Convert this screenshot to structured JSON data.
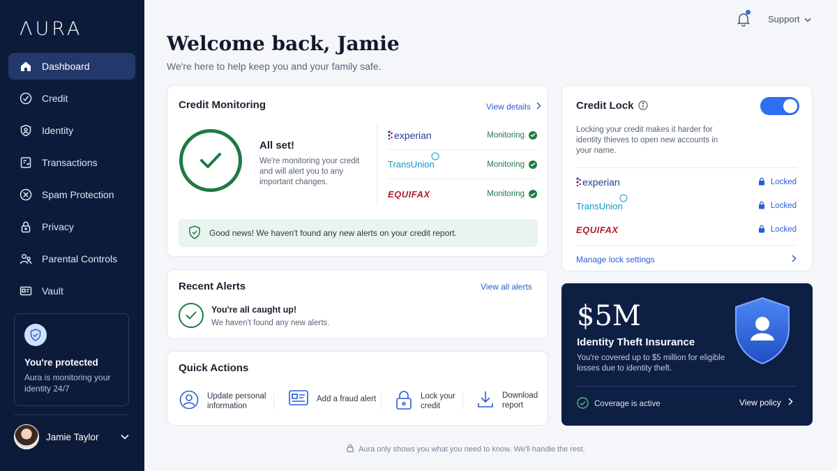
{
  "brand": {
    "logo_text": "ΛURA",
    "accent": "#2f6ef0",
    "success": "#1e7a43",
    "sidebar_bg": "#0d1b3a"
  },
  "sidebar": {
    "items": [
      {
        "label": "Dashboard",
        "icon": "home-icon",
        "active": true
      },
      {
        "label": "Credit",
        "icon": "credit-gauge-icon"
      },
      {
        "label": "Identity",
        "icon": "identity-shield-icon"
      },
      {
        "label": "Transactions",
        "icon": "transactions-icon"
      },
      {
        "label": "Spam Protection",
        "icon": "spam-block-icon"
      },
      {
        "label": "Privacy",
        "icon": "lock-icon"
      },
      {
        "label": "Parental Controls",
        "icon": "family-icon"
      },
      {
        "label": "Vault",
        "icon": "vault-card-icon"
      }
    ],
    "protect_card": {
      "title": "You're protected",
      "subtitle": "Aura is monitoring your identity 24/7"
    },
    "user": {
      "name": "Jamie Taylor"
    }
  },
  "topbar": {
    "support_label": "Support"
  },
  "header": {
    "title": "Welcome back, Jamie",
    "subtitle": "We're here to help keep you and your family safe."
  },
  "credit_monitoring": {
    "title": "Credit Monitoring",
    "view_details": "View details",
    "status_title": "All set!",
    "status_text": "We're monitoring your credit and will alert you to any important changes.",
    "bureaus": [
      {
        "name": "experian",
        "status": "Monitoring"
      },
      {
        "name": "TransUnion",
        "status": "Monitoring"
      },
      {
        "name": "EQUIFAX",
        "status": "Monitoring"
      }
    ],
    "good_news": "Good news! We haven't found any new alerts on your credit report."
  },
  "recent_alerts": {
    "title": "Recent Alerts",
    "view_all": "View all alerts",
    "status_title": "You're all caught up!",
    "status_text": "We haven't found any new alerts."
  },
  "quick_actions": {
    "title": "Quick Actions",
    "items": [
      {
        "line1": "Update personal",
        "line2": "information",
        "icon": "user-circle-icon"
      },
      {
        "line1": "Add a fraud alert",
        "line2": "",
        "icon": "id-card-icon"
      },
      {
        "line1": "Lock your",
        "line2": "credit",
        "icon": "padlock-icon"
      },
      {
        "line1": "Download",
        "line2": "report",
        "icon": "download-icon"
      }
    ]
  },
  "credit_lock": {
    "title": "Credit Lock",
    "toggle_on": true,
    "description": "Locking your credit makes it harder for identity thieves to open new accounts in your name.",
    "bureaus": [
      {
        "name": "experian",
        "status": "Locked"
      },
      {
        "name": "TransUnion",
        "status": "Locked"
      },
      {
        "name": "EQUIFAX",
        "status": "Locked"
      }
    ],
    "manage_link": "Manage lock settings"
  },
  "insurance": {
    "amount": "$5M",
    "title": "Identity Theft Insurance",
    "text": "You're covered up to $5 million for eligible losses due to identity theft.",
    "coverage_status": "Coverage is active",
    "view_policy": "View policy"
  },
  "footer": {
    "text": "Aura only shows you what you need to know. We'll handle the rest."
  }
}
